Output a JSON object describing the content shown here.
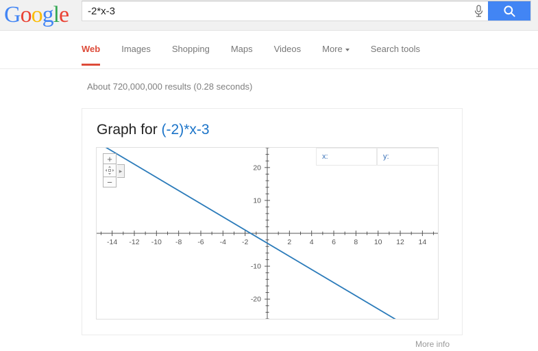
{
  "logo": {
    "letters": [
      {
        "char": "G",
        "color": "#4285f4"
      },
      {
        "char": "o",
        "color": "#ea4335"
      },
      {
        "char": "o",
        "color": "#fbbc05"
      },
      {
        "char": "g",
        "color": "#4285f4"
      },
      {
        "char": "l",
        "color": "#34a853"
      },
      {
        "char": "e",
        "color": "#ea4335"
      }
    ],
    "alt": "Google"
  },
  "search": {
    "value": "-2*x-3",
    "placeholder": "",
    "mic_icon": "microphone-icon",
    "button_icon": "search-icon",
    "button_color": "#4285f4"
  },
  "nav": {
    "tabs": [
      {
        "label": "Web",
        "active": true
      },
      {
        "label": "Images",
        "active": false
      },
      {
        "label": "Shopping",
        "active": false
      },
      {
        "label": "Maps",
        "active": false
      },
      {
        "label": "Videos",
        "active": false
      },
      {
        "label": "More",
        "active": false,
        "has_caret": true
      },
      {
        "label": "Search tools",
        "active": false
      }
    ],
    "active_color": "#dd4b39"
  },
  "results": {
    "stats": "About 720,000,000 results (0.28 seconds)"
  },
  "graph_card": {
    "title_prefix": "Graph for ",
    "title_formula": "(-2)*x-3",
    "formula_color": "#1a73c8",
    "coord_x_label": "x:",
    "coord_y_label": "y:",
    "coord_x_value": "",
    "coord_y_value": "",
    "controls": {
      "zoom_in": "+",
      "zoom_out": "−",
      "pan": "pan-icon",
      "expand": "▸"
    }
  },
  "footer": {
    "more_info": "More info"
  },
  "chart_data": {
    "type": "line",
    "title": "Graph for (-2)*x-3",
    "expression": "y = -2*x - 3",
    "slope": -2,
    "intercept": -3,
    "x_intercept": -1.5,
    "xlabel": "",
    "ylabel": "",
    "xlim": [
      -15.4,
      15.4
    ],
    "ylim": [
      -26,
      26
    ],
    "xticks": [
      -14,
      -12,
      -10,
      -8,
      -6,
      -4,
      -2,
      2,
      4,
      6,
      8,
      10,
      12,
      14
    ],
    "yticks": [
      20,
      10,
      -10,
      -20
    ],
    "tick_step_minor": 1,
    "grid": false,
    "legend": false,
    "line_color": "#2b7bba",
    "axis_color": "#555555",
    "series": [
      {
        "name": "(-2)*x-3",
        "x": [
          -15.4,
          15.4
        ],
        "y": [
          27.8,
          -33.8
        ]
      }
    ],
    "sample_points": [
      {
        "x": -10,
        "y": 17
      },
      {
        "x": -5,
        "y": 7
      },
      {
        "x": -1.5,
        "y": 0
      },
      {
        "x": 0,
        "y": -3
      },
      {
        "x": 5,
        "y": -13
      },
      {
        "x": 10,
        "y": -23
      }
    ]
  }
}
